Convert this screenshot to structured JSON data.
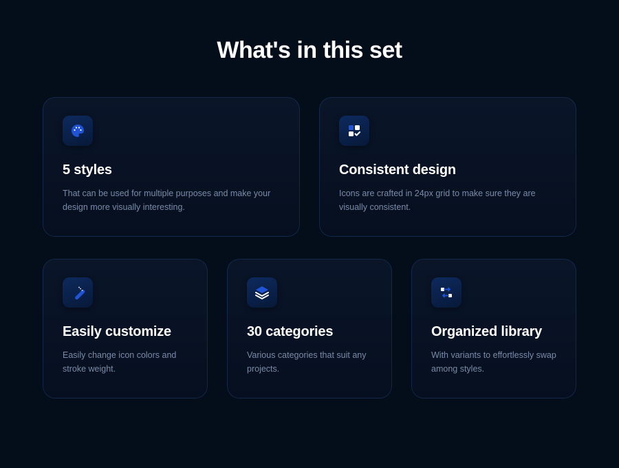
{
  "title": "What's in this set",
  "cards": [
    {
      "icon": "palette",
      "title": "5 styles",
      "description": "That can be used for multiple purposes and make your design more visually interesting."
    },
    {
      "icon": "grid-check",
      "title": "Consistent design",
      "description": "Icons are crafted in 24px grid to make sure they are visually consistent."
    },
    {
      "icon": "magic-wand",
      "title": "Easily customize",
      "description": "Easily change icon colors and stroke weight."
    },
    {
      "icon": "layers",
      "title": "30 categories",
      "description": "Various categories that suit any projects."
    },
    {
      "icon": "flow",
      "title": "Organized library",
      "description": "With variants to effortlessly swap among styles."
    }
  ]
}
